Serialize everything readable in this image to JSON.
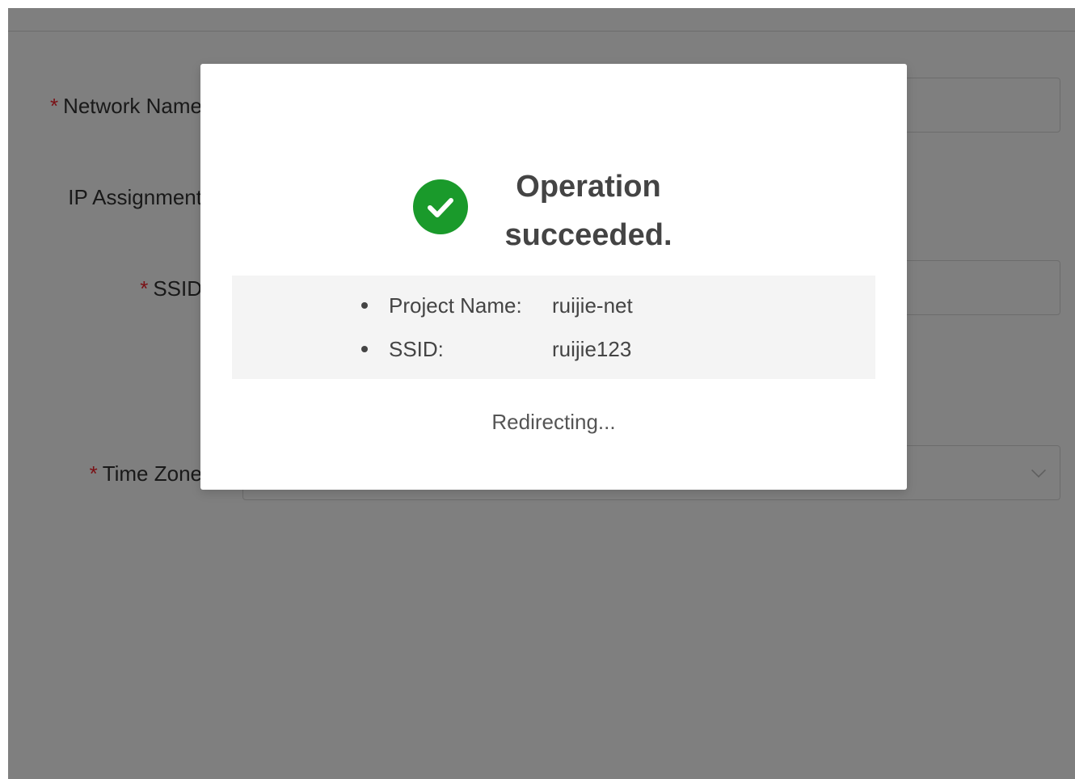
{
  "form": {
    "network_name_label": "Network Name",
    "ip_assignment_label": "IP Assignment",
    "ssid_label": "SSID",
    "time_zone_label": "Time Zone",
    "required_mark": "*"
  },
  "modal": {
    "title": "Operation succeeded.",
    "info": [
      {
        "key": "Project Name:",
        "value": "ruijie-net"
      },
      {
        "key": "SSID:",
        "value": "ruijie123"
      }
    ],
    "redirect_text": "Redirecting..."
  },
  "colors": {
    "success": "#1a9a2b",
    "required": "#f5222d",
    "overlay": "rgba(0,0,0,0.5)"
  },
  "icons": {
    "success": "check-circle-icon",
    "select_arrow": "chevron-down-icon"
  }
}
